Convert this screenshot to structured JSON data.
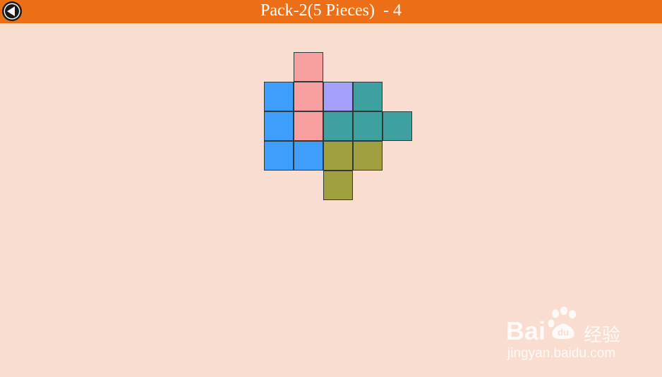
{
  "header": {
    "title": "Pack-2(5 Pieces)  - 4",
    "background_color": "#ec6f18",
    "back_icon": "back-arrow-icon"
  },
  "board": {
    "grid_columns": 5,
    "grid_rows": 5,
    "pieces": [
      {
        "name": "pink-piece",
        "color": "#f8a0a0",
        "cells": [
          [
            1,
            0
          ],
          [
            1,
            1
          ],
          [
            1,
            2
          ]
        ]
      },
      {
        "name": "blue-piece",
        "color": "#3f9dfc",
        "cells": [
          [
            0,
            1
          ],
          [
            0,
            2
          ],
          [
            0,
            3
          ],
          [
            1,
            3
          ]
        ]
      },
      {
        "name": "violet-piece",
        "color": "#a5a0fc",
        "cells": [
          [
            2,
            1
          ]
        ]
      },
      {
        "name": "teal-piece",
        "color": "#3fa0a0",
        "cells": [
          [
            3,
            1
          ],
          [
            2,
            2
          ],
          [
            3,
            2
          ],
          [
            4,
            2
          ]
        ]
      },
      {
        "name": "olive-piece",
        "color": "#a0a040",
        "cells": [
          [
            2,
            3
          ],
          [
            3,
            3
          ],
          [
            2,
            4
          ]
        ]
      }
    ]
  },
  "watermark": {
    "brand_left": "Bai",
    "brand_right": "经验",
    "paw_icon": "baidu-paw-icon",
    "paw_text": "du",
    "url": "jingyan.baidu.com"
  }
}
